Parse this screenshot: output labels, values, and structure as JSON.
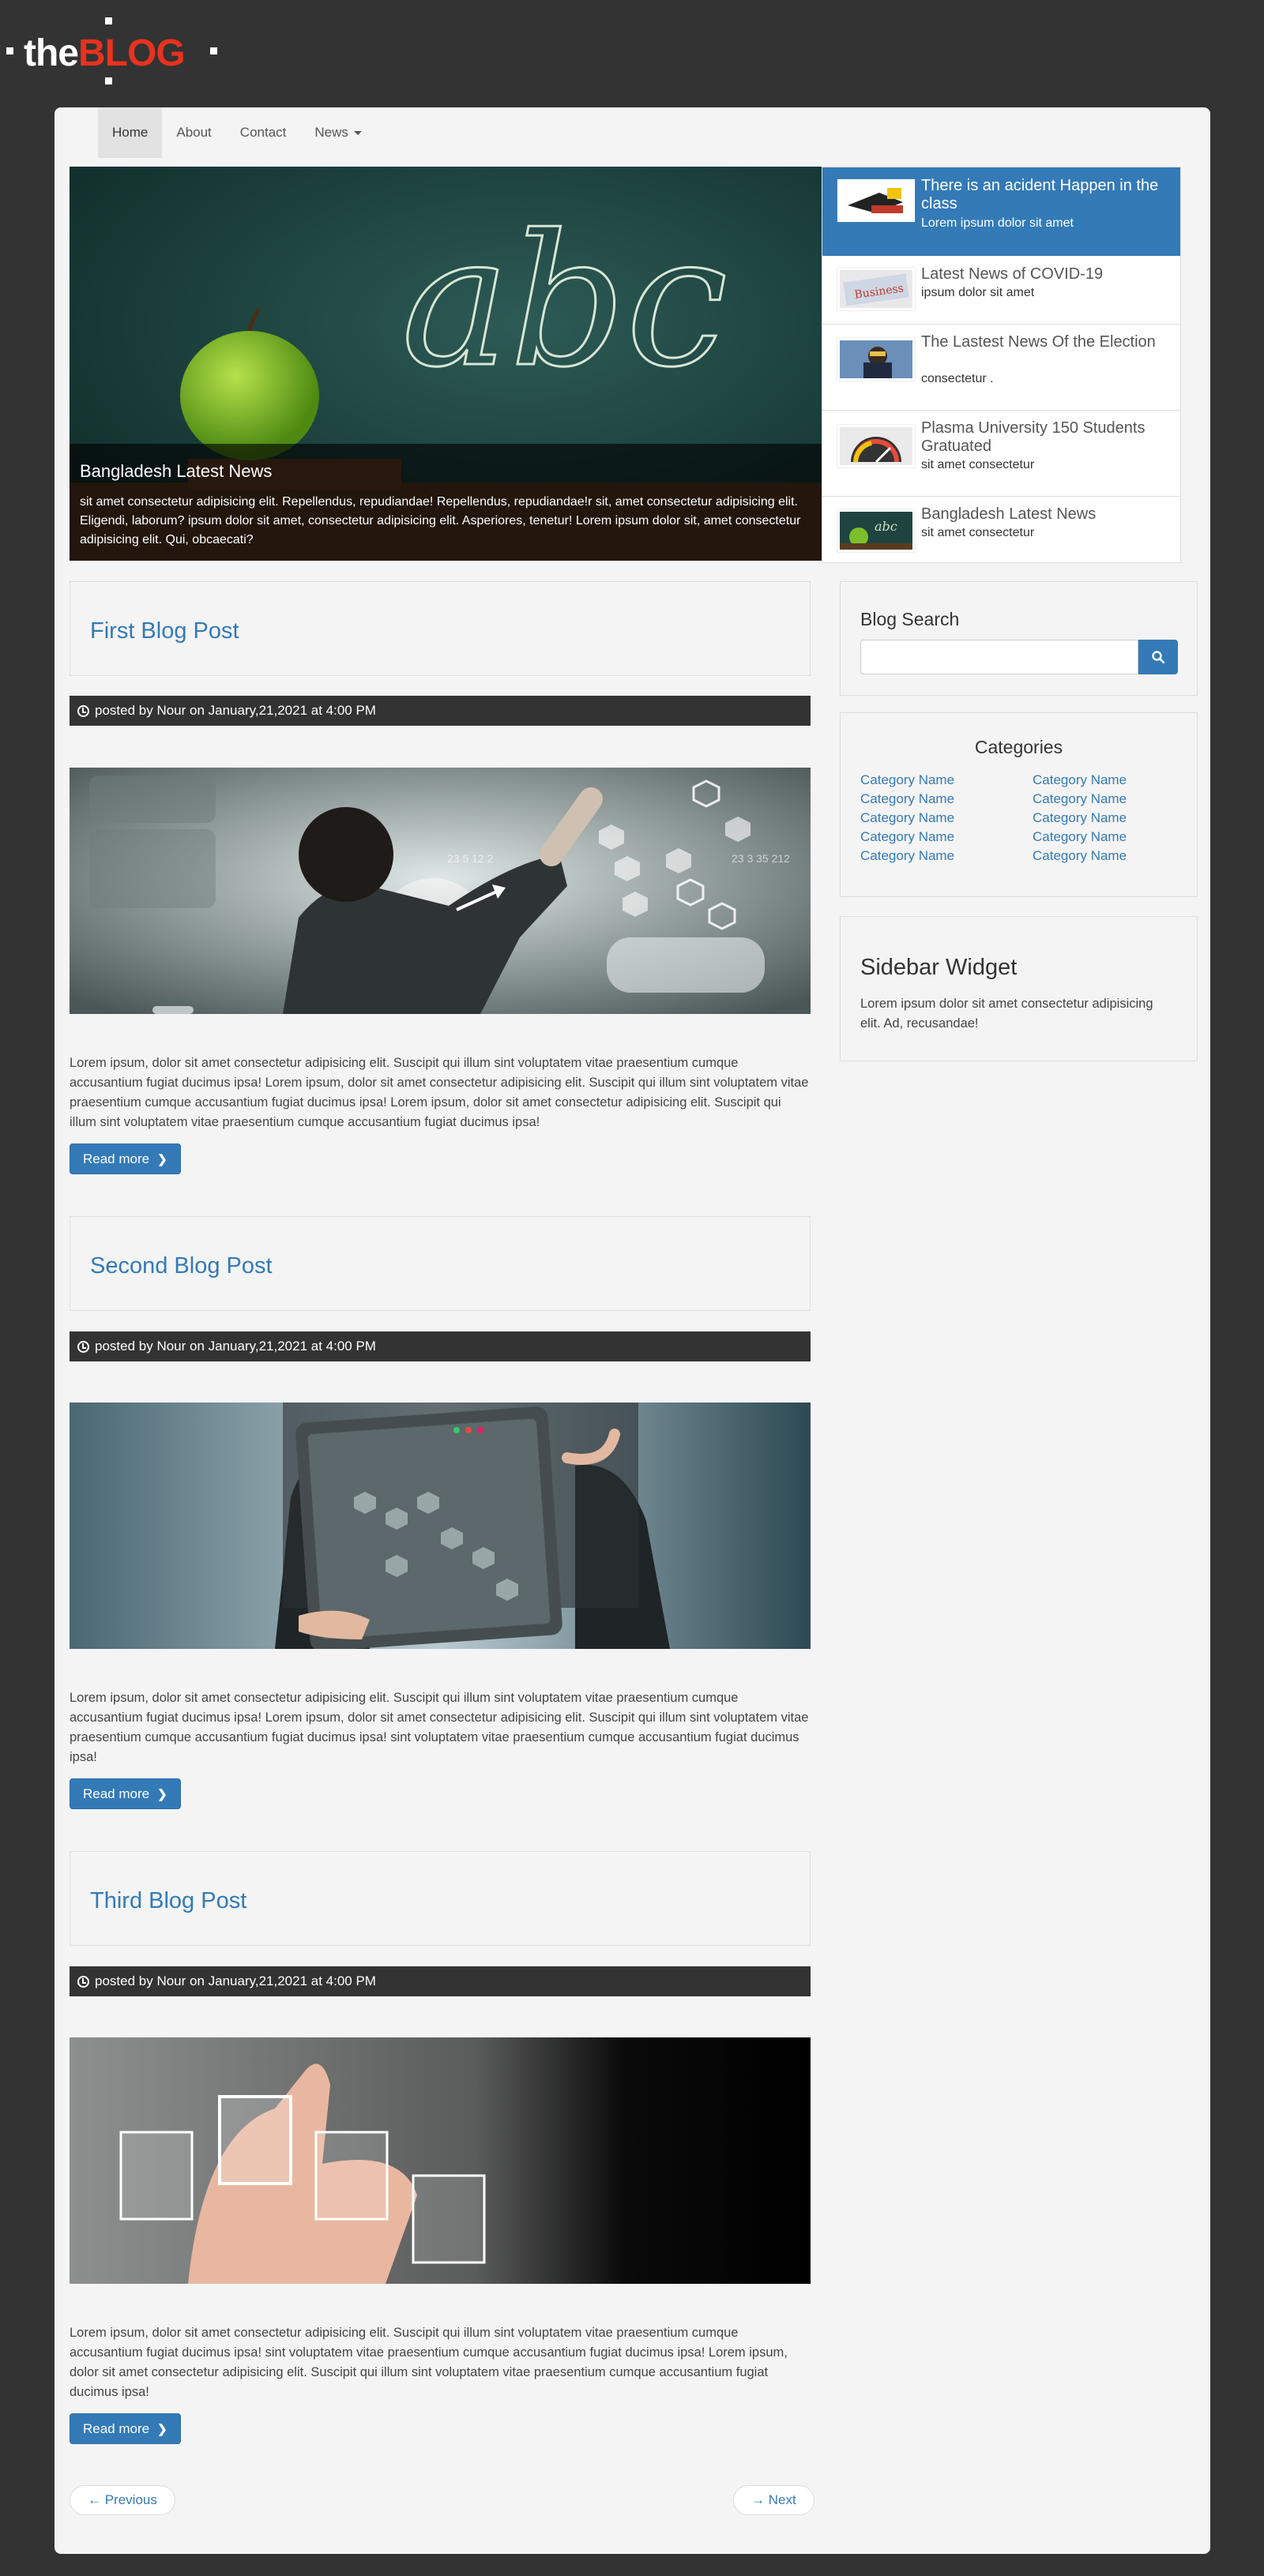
{
  "logo": {
    "the": "the",
    "blog": "BLOG"
  },
  "nav": {
    "items": [
      {
        "label": "Home",
        "active": true
      },
      {
        "label": "About",
        "active": false
      },
      {
        "label": "Contact",
        "active": false
      },
      {
        "label": "News",
        "active": false,
        "dropdown": true
      }
    ]
  },
  "slider": {
    "caption_title": "Bangladesh Latest News",
    "caption_text": "sit amet consectetur adipisicing elit. Repellendus, repudiandae! Repellendus, repudiandae!r sit, amet consectetur adipisicing elit. Eligendi, laborum? ipsum dolor sit amet, consectetur adipisicing elit. Asperiores, tenetur! Lorem ipsum dolor sit, amet consectetur adipisicing elit. Qui, obcaecati?",
    "chalkboard_text": "abc"
  },
  "news_list": [
    {
      "title": "There is an acident Happen in the class",
      "subtitle": "Lorem ipsum dolor sit amet",
      "active": true
    },
    {
      "title": "Latest News of COVID-19",
      "subtitle": "ipsum dolor sit amet",
      "active": false
    },
    {
      "title": "The Lastest News Of the Election",
      "subtitle": "consectetur .",
      "active": false
    },
    {
      "title": "Plasma University 150 Students Gratuated",
      "subtitle": "sit amet consectetur",
      "active": false
    },
    {
      "title": "Bangladesh Latest News",
      "subtitle": "sit amet consectetur",
      "active": false
    }
  ],
  "posts": [
    {
      "title": "First Blog Post",
      "meta": "posted by Nour on January,21,2021 at 4:00 PM",
      "excerpt": "Lorem ipsum, dolor sit amet consectetur adipisicing elit. Suscipit qui illum sint voluptatem vitae praesentium cumque accusantium fugiat ducimus ipsa! Lorem ipsum, dolor sit amet consectetur adipisicing elit. Suscipit qui illum sint voluptatem vitae praesentium cumque accusantium fugiat ducimus ipsa! Lorem ipsum, dolor sit amet consectetur adipisicing elit. Suscipit qui illum sint voluptatem vitae praesentium cumque accusantium fugiat ducimus ipsa!",
      "read_more": "Read more",
      "image_numbers": "23 5 12 2",
      "image_numbers_right": "23 3 35 212"
    },
    {
      "title": "Second Blog Post",
      "meta": "posted by Nour on January,21,2021 at 4:00 PM",
      "excerpt": "Lorem ipsum, dolor sit amet consectetur adipisicing elit. Suscipit qui illum sint voluptatem vitae praesentium cumque accusantium fugiat ducimus ipsa! Lorem ipsum, dolor sit amet consectetur adipisicing elit. Suscipit qui illum sint voluptatem vitae praesentium cumque accusantium fugiat ducimus ipsa! sint voluptatem vitae praesentium cumque accusantium fugiat ducimus ipsa!",
      "read_more": "Read more"
    },
    {
      "title": "Third Blog Post",
      "meta": "posted by Nour on January,21,2021 at 4:00 PM",
      "excerpt": "Lorem ipsum, dolor sit amet consectetur adipisicing elit. Suscipit qui illum sint voluptatem vitae praesentium cumque accusantium fugiat ducimus ipsa! sint voluptatem vitae praesentium cumque accusantium fugiat ducimus ipsa! Lorem ipsum, dolor sit amet consectetur adipisicing elit. Suscipit qui illum sint voluptatem vitae praesentium cumque accusantium fugiat ducimus ipsa!",
      "read_more": "Read more"
    }
  ],
  "pager": {
    "previous": "← Previous",
    "next": "→ Next"
  },
  "sidebar": {
    "search": {
      "title": "Blog Search",
      "placeholder": ""
    },
    "categories": {
      "title": "Categories",
      "left": [
        "Category Name",
        "Category Name",
        "Category Name",
        "Category Name",
        "Category Name"
      ],
      "right": [
        "Category Name",
        "Category Name",
        "Category Name",
        "Category Name",
        "Category Name"
      ]
    },
    "widget": {
      "title": "Sidebar Widget",
      "text": "Lorem ipsum dolor sit amet consectetur adipisicing elit. Ad, recusandae!"
    }
  },
  "colors": {
    "accent": "#337ab7",
    "logo_red": "#e8321e",
    "background": "#333333",
    "panel": "#f4f4f4"
  }
}
